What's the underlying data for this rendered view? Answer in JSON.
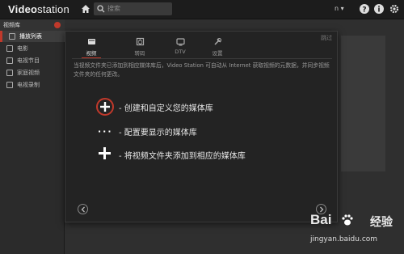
{
  "topbar": {
    "logo_prefix": "Video",
    "logo_suffix": "station",
    "search_placeholder": "搜索",
    "user": "n ▾"
  },
  "sidebar": {
    "title": "视频库",
    "items": [
      {
        "label": "播放列表",
        "active": true
      },
      {
        "label": "电影"
      },
      {
        "label": "电视节目"
      },
      {
        "label": "家庭视频"
      },
      {
        "label": "电视录制"
      }
    ]
  },
  "dialog": {
    "skip": "跳过",
    "tabs": [
      {
        "label": "视频",
        "icon": "video-icon",
        "active": true
      },
      {
        "label": "转码",
        "icon": "transcode-icon"
      },
      {
        "label": "DTV",
        "icon": "tv-icon"
      },
      {
        "label": "设置",
        "icon": "settings-icon"
      }
    ],
    "description": "当视频文件夹已添加到相应媒体库后，Video Station 可自动从 Internet 获取视频的元数据，并同步视频文件夹的任何更改。",
    "steps": [
      {
        "label": "- 创建和自定义您的媒体库",
        "icon": "circle-plus-icon"
      },
      {
        "label": "- 配置要显示的媒体库",
        "icon": "dots-icon"
      },
      {
        "label": "- 将视频文件夹添加到相应的媒体库",
        "icon": "plus-icon"
      }
    ]
  },
  "watermark": {
    "brand": "Bai",
    "brand_suffix": "经验",
    "url": "jingyan.baidu.com"
  },
  "colors": {
    "accent": "#c0392b",
    "background": "#262626",
    "dialog": "#232323"
  }
}
